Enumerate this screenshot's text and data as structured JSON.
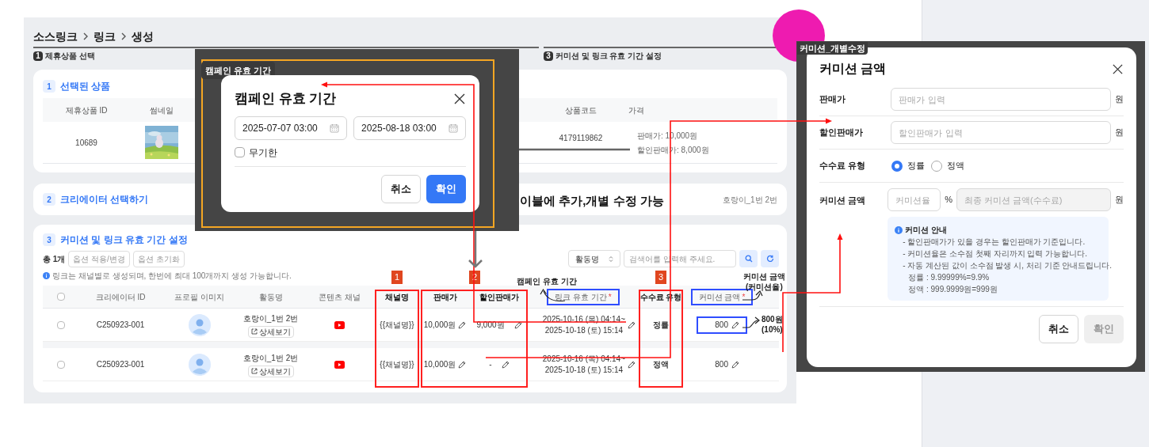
{
  "breadcrumb": [
    "소스링크",
    "링크",
    "생성"
  ],
  "steps": [
    {
      "number": "1",
      "label": "제휴상품 선택"
    },
    {
      "number": "3",
      "label": "커미션 및 링크 유효 기간 설정"
    }
  ],
  "product_card": {
    "number": "1",
    "title": "선택된 상품",
    "columns": [
      "제휴상품 ID",
      "썸네일",
      "상품코드",
      "가격"
    ],
    "row": {
      "product_id": "10689",
      "thumbnail": {
        "kind": "picture"
      },
      "product_code": "4179119862",
      "prices": [
        "판매가: 10,000원",
        "할인판매가: 8,000원"
      ]
    }
  },
  "creator_card": {
    "number": "2",
    "title": "크리에이터 선택하기",
    "selected_creators": "호랑이_1번 2번"
  },
  "commission_card": {
    "number": "3",
    "title": "커미션 및 링크 유효 기간 설정",
    "total": "총 1개",
    "buttons": [
      "옵션 적용/변경",
      "옵션 초기화"
    ],
    "info": "링크는 채널별로 생성되며, 한번에 최대 100개까지 생성 가능합니다.",
    "search_select": "활동명",
    "search": {
      "placeholder": "검색어를 입력해 주세요."
    },
    "columns": [
      {
        "kind": "checkbox",
        "checked": false
      },
      {
        "kind": "text",
        "label": "크리에이터 ID",
        "emphasis": false
      },
      {
        "kind": "text",
        "label": "프로필 이미지",
        "emphasis": false
      },
      {
        "kind": "text",
        "label": "활동명",
        "emphasis": false
      },
      {
        "kind": "text",
        "label": "콘텐츠 채널",
        "emphasis": false
      },
      {
        "kind": "text",
        "label": "채널명",
        "emphasis": true
      },
      {
        "kind": "text",
        "label": "판매가",
        "emphasis": true
      },
      {
        "kind": "text",
        "label": "할인판매가",
        "emphasis": true
      },
      {
        "kind": "text",
        "label": "링크 유효 기간",
        "emphasis": false,
        "required_mark": "*",
        "highlighted": true
      },
      {
        "kind": "text",
        "label": "수수료 유형",
        "emphasis": true
      },
      {
        "kind": "text",
        "label": "커미션 금액",
        "emphasis": false,
        "required_mark": "*",
        "highlighted": true
      }
    ],
    "rows": [
      {
        "selected": false,
        "creator_id": "C250923-001",
        "activity": "호랑이_1번 2번",
        "detail_button": "상세보기",
        "channel_name": "{{채널명}}",
        "price": "10,000원",
        "discount_price": "9,000원",
        "period": [
          "2025-10-16 (목) 04:14~",
          "2025-10-18 (토) 15:14"
        ],
        "fee_type": "정률",
        "commission": "800",
        "highlighted": true
      },
      {
        "selected": false,
        "creator_id": "C250923-001",
        "activity": "호랑이_1번 2번",
        "detail_button": "상세보기",
        "channel_name": "{{채널명}}",
        "price": "10,000원",
        "discount_price": "-",
        "period": [
          "2025-10-16 (목) 04:14~",
          "2025-10-18 (토) 15:14"
        ],
        "fee_type": "정액",
        "commission": "800",
        "highlighted": false
      }
    ]
  },
  "annotations": {
    "note": "이블에 추가,개별 수정 가능",
    "badges": [
      "1",
      "2",
      "3"
    ],
    "period_label": [
      "캠페인 유효 기간"
    ],
    "commission_label": [
      "커미션 금액",
      "(커미션율)"
    ],
    "value_label": [
      "800원",
      "(10%)"
    ]
  },
  "period_dialog": {
    "tag": "캠페인 유효 기간",
    "title": "캠페인 유효 기간",
    "start": "2025-07-07 03:00",
    "end": "2025-08-18 03:00",
    "unlimited": {
      "label": "무기한",
      "checked": false
    },
    "buttons": [
      {
        "label": "취소",
        "kind": "secondary"
      },
      {
        "label": "확인",
        "kind": "primary"
      }
    ]
  },
  "commission_dialog": {
    "tag": "커미션_개별수정",
    "title": "커미션 금액",
    "fields": [
      {
        "kind": "input",
        "label": "판매가",
        "placeholder": "판매가 입력",
        "unit": "원"
      },
      {
        "kind": "input",
        "label": "할인판매가",
        "placeholder": "할인판매가 입력",
        "unit": "원"
      },
      {
        "kind": "radio",
        "label": "수수료 유형",
        "options": [
          {
            "label": "정률",
            "selected": true
          },
          {
            "label": "정액",
            "selected": false
          }
        ]
      },
      {
        "kind": "commission",
        "label": "커미션 금액",
        "rate_placeholder": "커미션율",
        "percent": "%",
        "final_placeholder": "최종 커미션 금액(수수료)",
        "final_disabled": true,
        "unit": "원"
      }
    ],
    "guide": {
      "title": "커미션 안내",
      "lines": [
        "- 할인판매가가 있을 경우는 할인판매가 기준입니다.",
        "- 커미션율은 소수점 첫째 자리까지 입력 가능합니다.",
        "- 자동 계산된 값이 소수점 발생 시, 처리 기준 안내드립니다."
      ],
      "examples": [
        "정률 : 9.99999%=9.9%",
        "정액 : 999.9999원=999원"
      ]
    },
    "buttons": [
      {
        "label": "취소",
        "kind": "secondary",
        "disabled": false
      },
      {
        "label": "확인",
        "kind": "primary",
        "disabled": true
      }
    ]
  }
}
